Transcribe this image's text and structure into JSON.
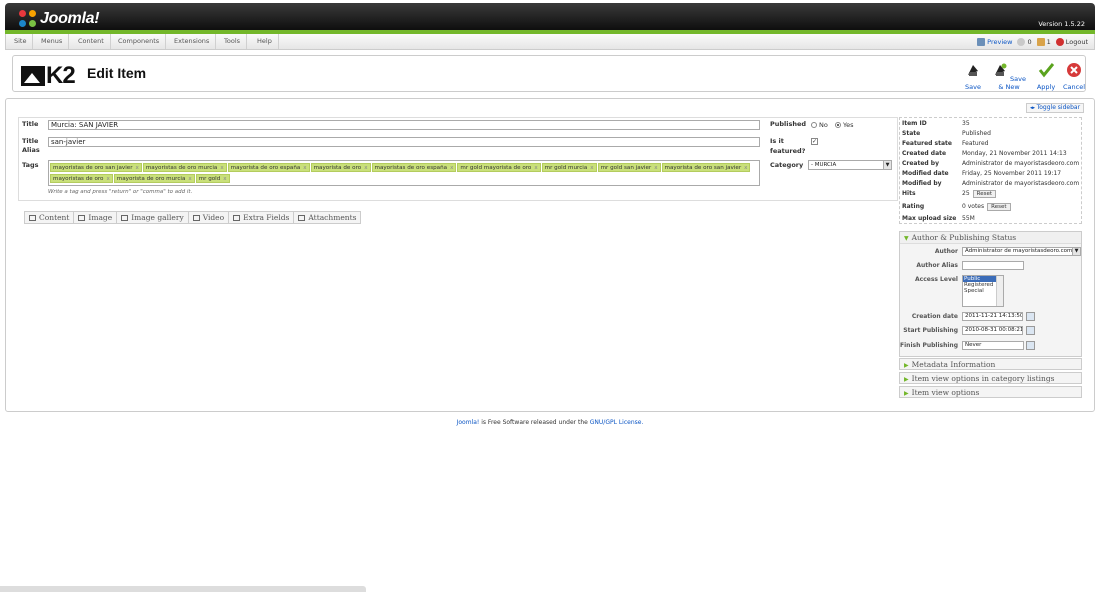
{
  "header": {
    "brand": "Joomla!",
    "version": "Version 1.5.22"
  },
  "menu": [
    "Site",
    "Menus",
    "Content",
    "Components",
    "Extensions",
    "Tools",
    "Help"
  ],
  "status": {
    "preview": "Preview",
    "messages": "0",
    "users": "1",
    "logout": "Logout"
  },
  "page": {
    "logo_text": "K2",
    "title": "Edit Item"
  },
  "toolbar": {
    "save": "Save",
    "save_new": "Save & New",
    "apply": "Apply",
    "cancel": "Cancel"
  },
  "toggle_sidebar": "Toggle sidebar",
  "form": {
    "title_label": "Title",
    "title_value": "Murcia: SAN JAVIER",
    "alias_label_1": "Title",
    "alias_label_2": "Alias",
    "alias_value": "san-javier",
    "tags_label": "Tags",
    "tags": [
      "mayoristas de oro san javier",
      "mayoristas de oro murcia",
      "mayorista de oro españa",
      "mayorista de oro",
      "mayoristas de oro españa",
      "mr gold mayorista de oro",
      "mr gold murcia",
      "mr gold san javier",
      "mayorista de oro san javier",
      "mayoristas de oro",
      "mayorista de oro murcia",
      "mr gold"
    ],
    "tag_remove": "x",
    "tag_hint": "Write a tag and press \"return\" or \"comma\" to add it.",
    "published_label": "Published",
    "no": "No",
    "yes": "Yes",
    "featured_label_1": "Is it",
    "featured_label_2": "featured?",
    "category_label": "Category",
    "category_value": "- MURCIA"
  },
  "tabs": [
    "Content",
    "Image",
    "Image gallery",
    "Video",
    "Extra Fields",
    "Attachments"
  ],
  "info": [
    {
      "k": "Item ID",
      "v": "35"
    },
    {
      "k": "State",
      "v": "Published"
    },
    {
      "k": "Featured state",
      "v": "Featured"
    },
    {
      "k": "Created date",
      "v": "Monday, 21 November 2011 14:13"
    },
    {
      "k": "Created by",
      "v": "Administrator de mayoristasdeoro.com"
    },
    {
      "k": "Modified date",
      "v": "Friday, 25 November 2011 19:17"
    },
    {
      "k": "Modified by",
      "v": "Administrator de mayoristasdeoro.com"
    },
    {
      "k": "Hits",
      "v": "25"
    },
    {
      "k": "Rating",
      "v": "0 votes"
    },
    {
      "k": "Max upload size",
      "v": "55M"
    }
  ],
  "reset": "Reset",
  "publishing": {
    "title": "Author & Publishing Status",
    "author_label": "Author",
    "author_value": "Administrator de mayoristasdeoro.com",
    "alias_label": "Author Alias",
    "access_label": "Access Level",
    "access_options": [
      "Public",
      "Registered",
      "Special"
    ],
    "creation_label": "Creation date",
    "creation_value": "2011-11-21 14:13:50",
    "start_label": "Start Publishing",
    "start_value": "2010-08-31 00:08:21",
    "finish_label": "Finish Publishing",
    "finish_value": "Never"
  },
  "accordions": [
    "Metadata Information",
    "Item view options in category listings",
    "Item view options"
  ],
  "footer": {
    "brand": "Joomla!",
    "text": " is Free Software released under the ",
    "license": "GNU/GPL License."
  },
  "colors": {
    "green": "#73b72a",
    "link": "#0b55c4",
    "tag": "#c9e07a"
  }
}
